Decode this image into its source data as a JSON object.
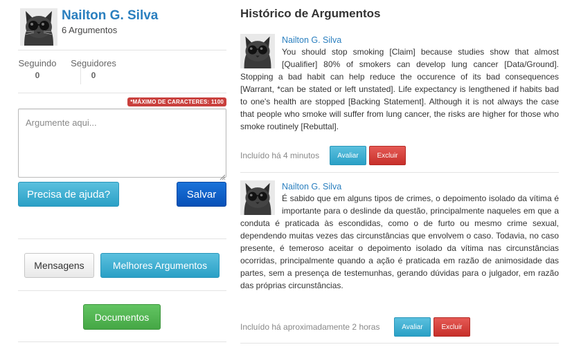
{
  "profile": {
    "name": "Nailton G. Silva",
    "count": "6 Argumentos",
    "following_label": "Seguindo",
    "following_value": "0",
    "followers_label": "Seguidores",
    "followers_value": "0"
  },
  "composer": {
    "max_badge": "*MÁXIMO DE CARACTERES: 1100",
    "placeholder": "Argumente aqui...",
    "help_button": "Precisa de ajuda?",
    "save_button": "Salvar"
  },
  "nav": {
    "messages_button": "Mensagens",
    "best_button": "Melhores Argumentos",
    "docs_button": "Documentos"
  },
  "history": {
    "title": "Histórico de Argumentos",
    "items": [
      {
        "author": "Nailton G. Silva",
        "text": "You should stop smoking [Claim] because studies show that almost [Qualifier] 80% of smokers can develop lung cancer [Data/Ground]. Stopping a bad habit can help reduce the occurence of its bad consequences [Warrant, *can be stated or left unstated]. Life expectancy is lengthened if habits bad to one's health are stopped [Backing Statement]. Although it is not always the case that people who smoke will suffer from lung cancer, the risks are higher for those who smoke routinely [Rebuttal].",
        "time": "Incluído há 4 minutos",
        "eval_button": "Avaliar",
        "delete_button": "Excluir"
      },
      {
        "author": "Nailton G. Silva",
        "text": "É sabido que em alguns tipos de crimes, o depoimento isolado da vítima é importante para o deslinde da questão, principalmente naqueles em que a conduta é praticada às escondidas, como o de furto ou mesmo crime sexual, dependendo muitas vezes das circunstâncias que envolvem o caso. Todavia, no caso presente, é temeroso aceitar o depoimento isolado da vítima nas circunstâncias ocorridas, principalmente quando a ação é praticada em razão de animosidade das partes, sem a presença de testemunhas, gerando dúvidas para o julgador, em razão das próprias circunstâncias.",
        "time": "Incluído há aproximadamente 2 horas",
        "eval_button": "Avaliar",
        "delete_button": "Excluir"
      }
    ]
  },
  "icons": {
    "avatar": "cat-with-sunglasses-avatar",
    "grip": "resize-grip-icon"
  }
}
